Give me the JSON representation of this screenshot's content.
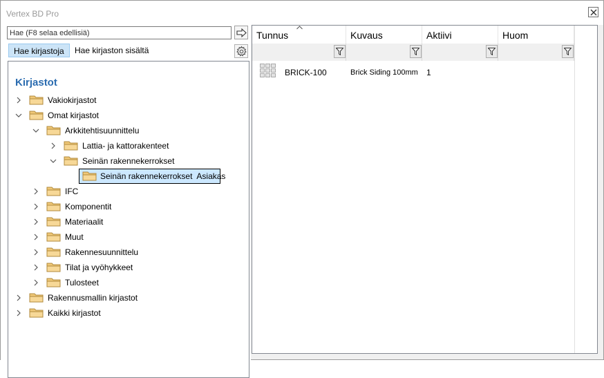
{
  "window": {
    "title": "Vertex BD Pro"
  },
  "search": {
    "placeholder": "Hae (F8 selaa edellisiä)"
  },
  "tabs": [
    {
      "label": "Hae kirjastoja",
      "active": true
    },
    {
      "label": "Hae kirjaston sisältä",
      "active": false
    }
  ],
  "tree": {
    "title": "Kirjastot",
    "nodes": [
      {
        "label": "Vakiokirjastot",
        "expanded": false
      },
      {
        "label": "Omat kirjastot",
        "expanded": true
      },
      {
        "label": "Arkkitehtisuunnittelu",
        "expanded": true
      },
      {
        "label": "Lattia- ja kattorakenteet",
        "expanded": false
      },
      {
        "label": "Seinän rakennekerrokset",
        "expanded": true
      },
      {
        "label": "Seinän rakennekerrokset  Asiakas",
        "selected": true
      },
      {
        "label": "IFC",
        "expanded": false
      },
      {
        "label": "Komponentit",
        "expanded": false
      },
      {
        "label": "Materiaalit",
        "expanded": false
      },
      {
        "label": "Muut",
        "expanded": false
      },
      {
        "label": "Rakennesuunnittelu",
        "expanded": false
      },
      {
        "label": "Tilat ja vyöhykkeet",
        "expanded": false
      },
      {
        "label": "Tulosteet",
        "expanded": false
      },
      {
        "label": "Rakennusmallin kirjastot",
        "expanded": false
      },
      {
        "label": "Kaikki kirjastot",
        "expanded": false
      }
    ]
  },
  "table": {
    "columns": [
      "Tunnus",
      "Kuvaus",
      "Aktiivi",
      "Huom"
    ],
    "sorted_column": "Tunnus",
    "rows": [
      {
        "tunnus": "BRICK-100",
        "kuvaus": "Brick Siding 100mm",
        "aktiivi": "1",
        "huom": ""
      }
    ]
  },
  "colors": {
    "accent_title": "#2b6cb0",
    "selection_fill": "#cce8ff",
    "active_tab": "#cce4f7",
    "folder": "#f0c878"
  }
}
